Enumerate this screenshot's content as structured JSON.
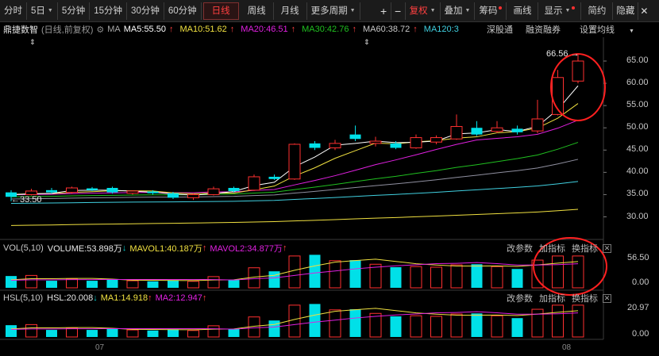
{
  "toolbar": {
    "periods": [
      "分时",
      "5日",
      "5分钟",
      "15分钟",
      "30分钟",
      "60分钟",
      "日线",
      "周线",
      "月线",
      "更多周期"
    ],
    "active_period": "日线",
    "plus": "+",
    "minus": "−",
    "fuquan": "复权",
    "diejia": "叠加",
    "chouma": "筹码",
    "huaxian": "画线",
    "xianshi": "显示",
    "jianyue": "简约",
    "yincang": "隐藏"
  },
  "main": {
    "stock_name": "鼎捷数智",
    "chart_mode": "(日线,前复权)",
    "ma_label": "MA",
    "ma5": "MA5:55.50",
    "ma10": "MA10:51.62",
    "ma20": "MA20:46.51",
    "ma30": "MA30:42.76",
    "ma60": "MA60:38.72",
    "ma120": "MA120:3",
    "arrow_up": "↑",
    "tab_shenzhen": "深股通",
    "tab_rongzi": "融资融券",
    "tab_setma": "设置均线",
    "high_label": "66.56",
    "low_label": "33.50",
    "price_ticks": [
      "65.00",
      "60.00",
      "55.00",
      "50.00",
      "45.00",
      "40.00",
      "35.00",
      "30.00"
    ]
  },
  "vol": {
    "title": "VOL(5,10)",
    "volume": "VOLUME:53.898万",
    "mavol1": "MAVOL1:40.187万",
    "mavol2": "MAVOL2:34.877万",
    "btn_params": "改参数",
    "btn_add": "加指标",
    "btn_switch": "换指标",
    "ticks": [
      "56.50",
      "0.00"
    ]
  },
  "hsl": {
    "title": "HSL(5,10)",
    "hsl": "HSL:20.008",
    "ma1": "MA1:14.918",
    "ma2": "MA2:12.947",
    "btn_params": "改参数",
    "btn_add": "加指标",
    "btn_switch": "换指标",
    "ticks": [
      "20.97",
      "0.00"
    ]
  },
  "xaxis": {
    "labels": [
      "07",
      "08"
    ]
  },
  "colors": {
    "up": "#ff3030",
    "down": "#00e0e8",
    "ma5": "#ffffff",
    "ma10": "#f0e040",
    "ma20": "#e020e0",
    "ma30": "#20c020",
    "ma60": "#9090a0",
    "ma120": "#40d0e0",
    "highlight": "#ff2020"
  },
  "chart_data": {
    "type": "candlestick",
    "candles": [
      {
        "o": 35.5,
        "c": 34.5,
        "h": 36.0,
        "l": 33.5,
        "v": 20,
        "up": false
      },
      {
        "o": 35.0,
        "c": 35.8,
        "h": 36.3,
        "l": 34.8,
        "v": 21,
        "up": true
      },
      {
        "o": 36.0,
        "c": 35.5,
        "h": 36.5,
        "l": 35.2,
        "v": 12,
        "up": false
      },
      {
        "o": 35.5,
        "c": 36.5,
        "h": 36.8,
        "l": 35.2,
        "v": 15,
        "up": true
      },
      {
        "o": 36.4,
        "c": 36.0,
        "h": 36.7,
        "l": 35.8,
        "v": 12,
        "up": false
      },
      {
        "o": 36.5,
        "c": 35.5,
        "h": 36.8,
        "l": 35.2,
        "v": 14,
        "up": false
      },
      {
        "o": 35.3,
        "c": 35.8,
        "h": 36.0,
        "l": 35.0,
        "v": 12,
        "up": true
      },
      {
        "o": 35.7,
        "c": 35.3,
        "h": 36.0,
        "l": 35.0,
        "v": 11,
        "up": false
      },
      {
        "o": 35.3,
        "c": 34.3,
        "h": 35.6,
        "l": 34.0,
        "v": 13,
        "up": false
      },
      {
        "o": 34.3,
        "c": 35.0,
        "h": 35.3,
        "l": 33.8,
        "v": 11,
        "up": true
      },
      {
        "o": 35.0,
        "c": 36.3,
        "h": 36.8,
        "l": 34.8,
        "v": 19,
        "up": true
      },
      {
        "o": 36.5,
        "c": 35.8,
        "h": 36.8,
        "l": 35.5,
        "v": 14,
        "up": false
      },
      {
        "o": 36.0,
        "c": 39.0,
        "h": 39.5,
        "l": 35.8,
        "v": 34,
        "up": true
      },
      {
        "o": 39.0,
        "c": 38.5,
        "h": 39.5,
        "l": 38.3,
        "v": 28,
        "up": false
      },
      {
        "o": 38.5,
        "c": 46.3,
        "h": 46.5,
        "l": 38.3,
        "v": 54,
        "up": true
      },
      {
        "o": 46.5,
        "c": 45.5,
        "h": 47.0,
        "l": 45.0,
        "v": 56,
        "up": false
      },
      {
        "o": 45.5,
        "c": 46.5,
        "h": 47.3,
        "l": 45.0,
        "v": 46,
        "up": true
      },
      {
        "o": 48.5,
        "c": 47.5,
        "h": 50.5,
        "l": 47.0,
        "v": 47,
        "up": false
      },
      {
        "o": 46.5,
        "c": 47.0,
        "h": 48.0,
        "l": 45.8,
        "v": 40,
        "up": true
      },
      {
        "o": 46.5,
        "c": 45.5,
        "h": 47.0,
        "l": 45.2,
        "v": 35,
        "up": false
      },
      {
        "o": 45.5,
        "c": 47.8,
        "h": 48.5,
        "l": 45.3,
        "v": 36,
        "up": true
      },
      {
        "o": 46.8,
        "c": 47.8,
        "h": 48.3,
        "l": 46.3,
        "v": 35,
        "up": true
      },
      {
        "o": 47.5,
        "c": 50.3,
        "h": 53.0,
        "l": 47.3,
        "v": 39,
        "up": true
      },
      {
        "o": 50.0,
        "c": 48.5,
        "h": 51.5,
        "l": 48.2,
        "v": 40,
        "up": false
      },
      {
        "o": 49.2,
        "c": 50.0,
        "h": 51.5,
        "l": 48.8,
        "v": 36,
        "up": true
      },
      {
        "o": 49.8,
        "c": 49.0,
        "h": 50.5,
        "l": 48.5,
        "v": 32,
        "up": false
      },
      {
        "o": 49.3,
        "c": 52.0,
        "h": 56.3,
        "l": 48.8,
        "v": 47,
        "up": true
      },
      {
        "o": 53.0,
        "c": 61.3,
        "h": 63.0,
        "l": 52.8,
        "v": 54,
        "up": true
      },
      {
        "o": 60.5,
        "c": 65.0,
        "h": 66.56,
        "l": 60.0,
        "v": 54,
        "up": true
      }
    ]
  }
}
